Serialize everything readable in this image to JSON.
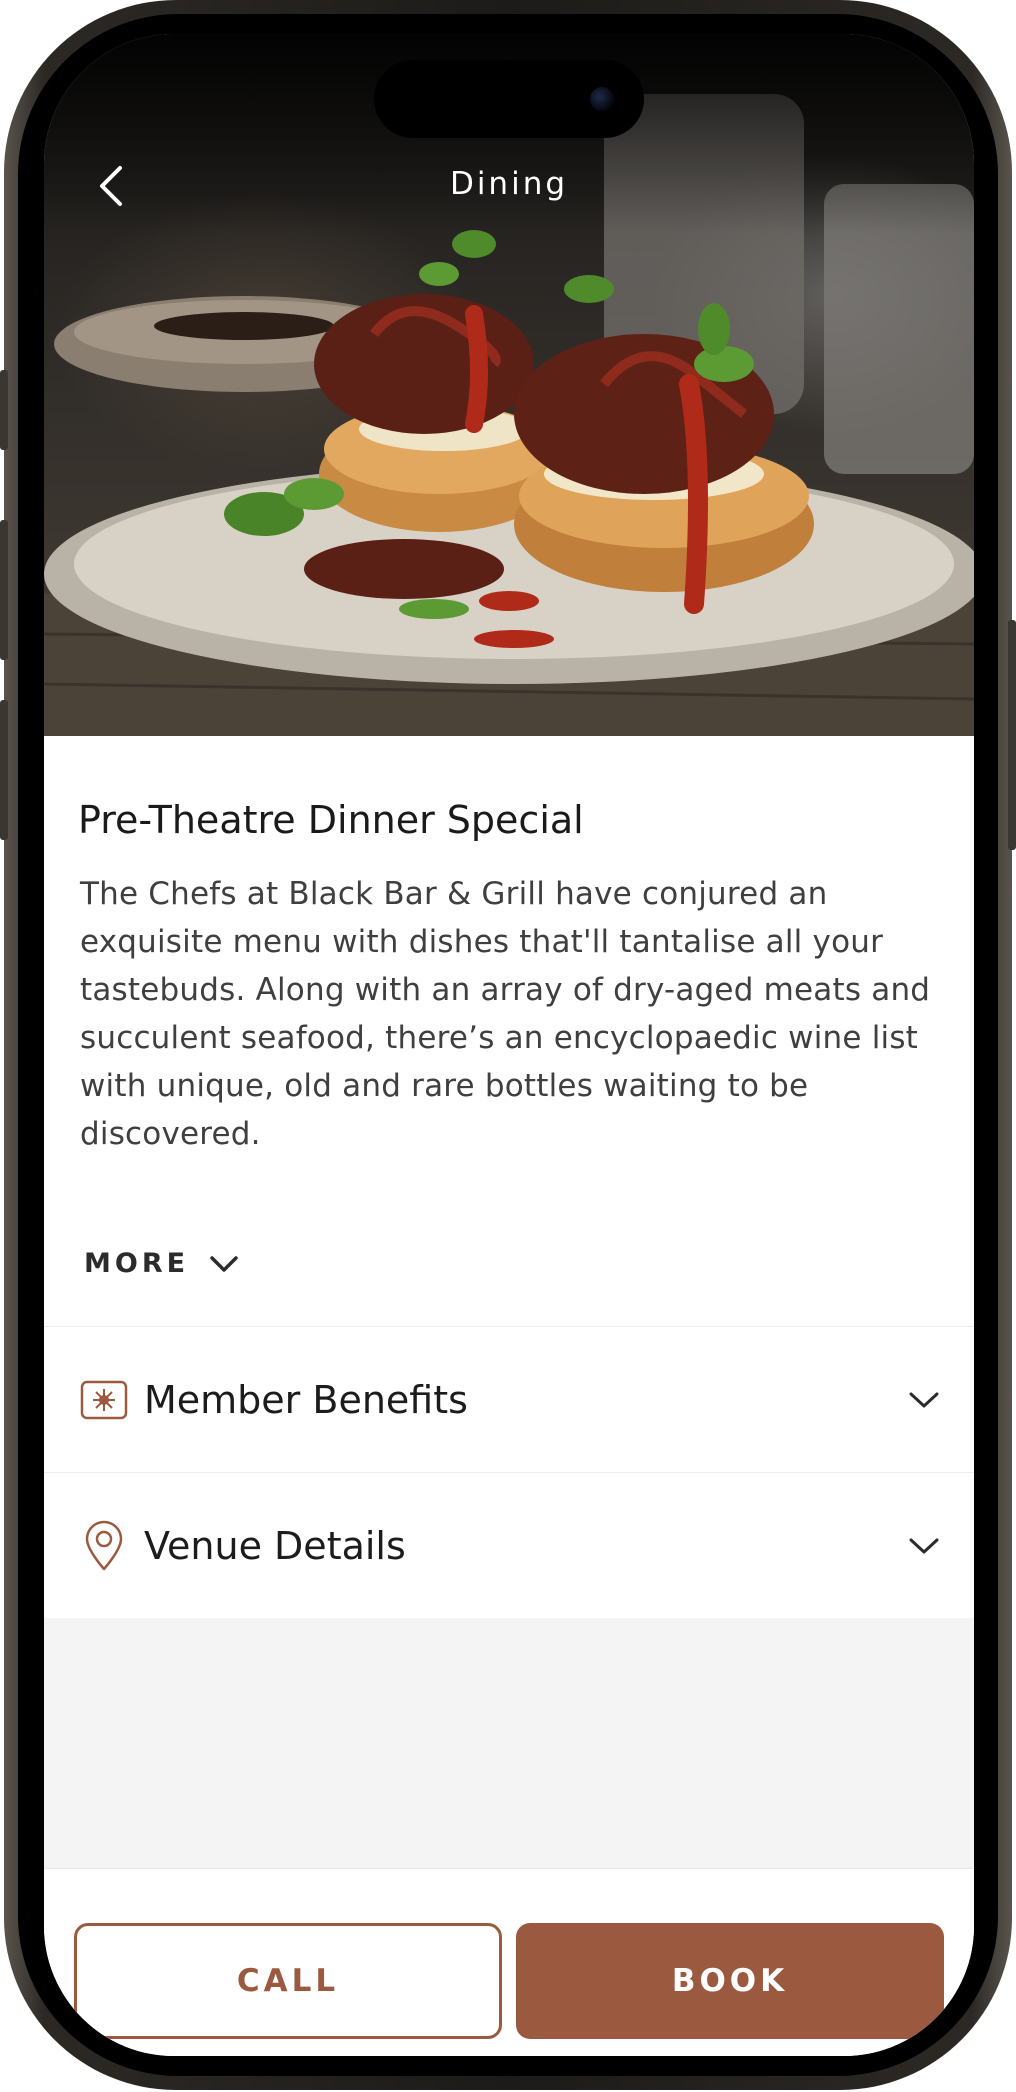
{
  "header": {
    "title": "Dining",
    "back_icon": "chevron-left-icon"
  },
  "offer": {
    "title": "Pre-Theatre Dinner Special",
    "description": "The Chefs at Black Bar & Grill have conjured an exquisite menu with dishes that'll tantalise all your tastebuds. Along with an array of dry-aged meats and succulent seafood, there’s an encyclopaedic wine list with unique, old and rare bottles waiting to be discovered.",
    "more_label": "MORE"
  },
  "sections": [
    {
      "label": "Member Benefits",
      "icon": "star-badge-icon"
    },
    {
      "label": "Venue Details",
      "icon": "location-pin-icon"
    }
  ],
  "actions": {
    "call_label": "CALL",
    "book_label": "BOOK"
  },
  "colors": {
    "accent": "#9b5a40",
    "text": "#1c1c1c",
    "muted_text": "#3f3f3f",
    "background": "#f4f4f4"
  }
}
